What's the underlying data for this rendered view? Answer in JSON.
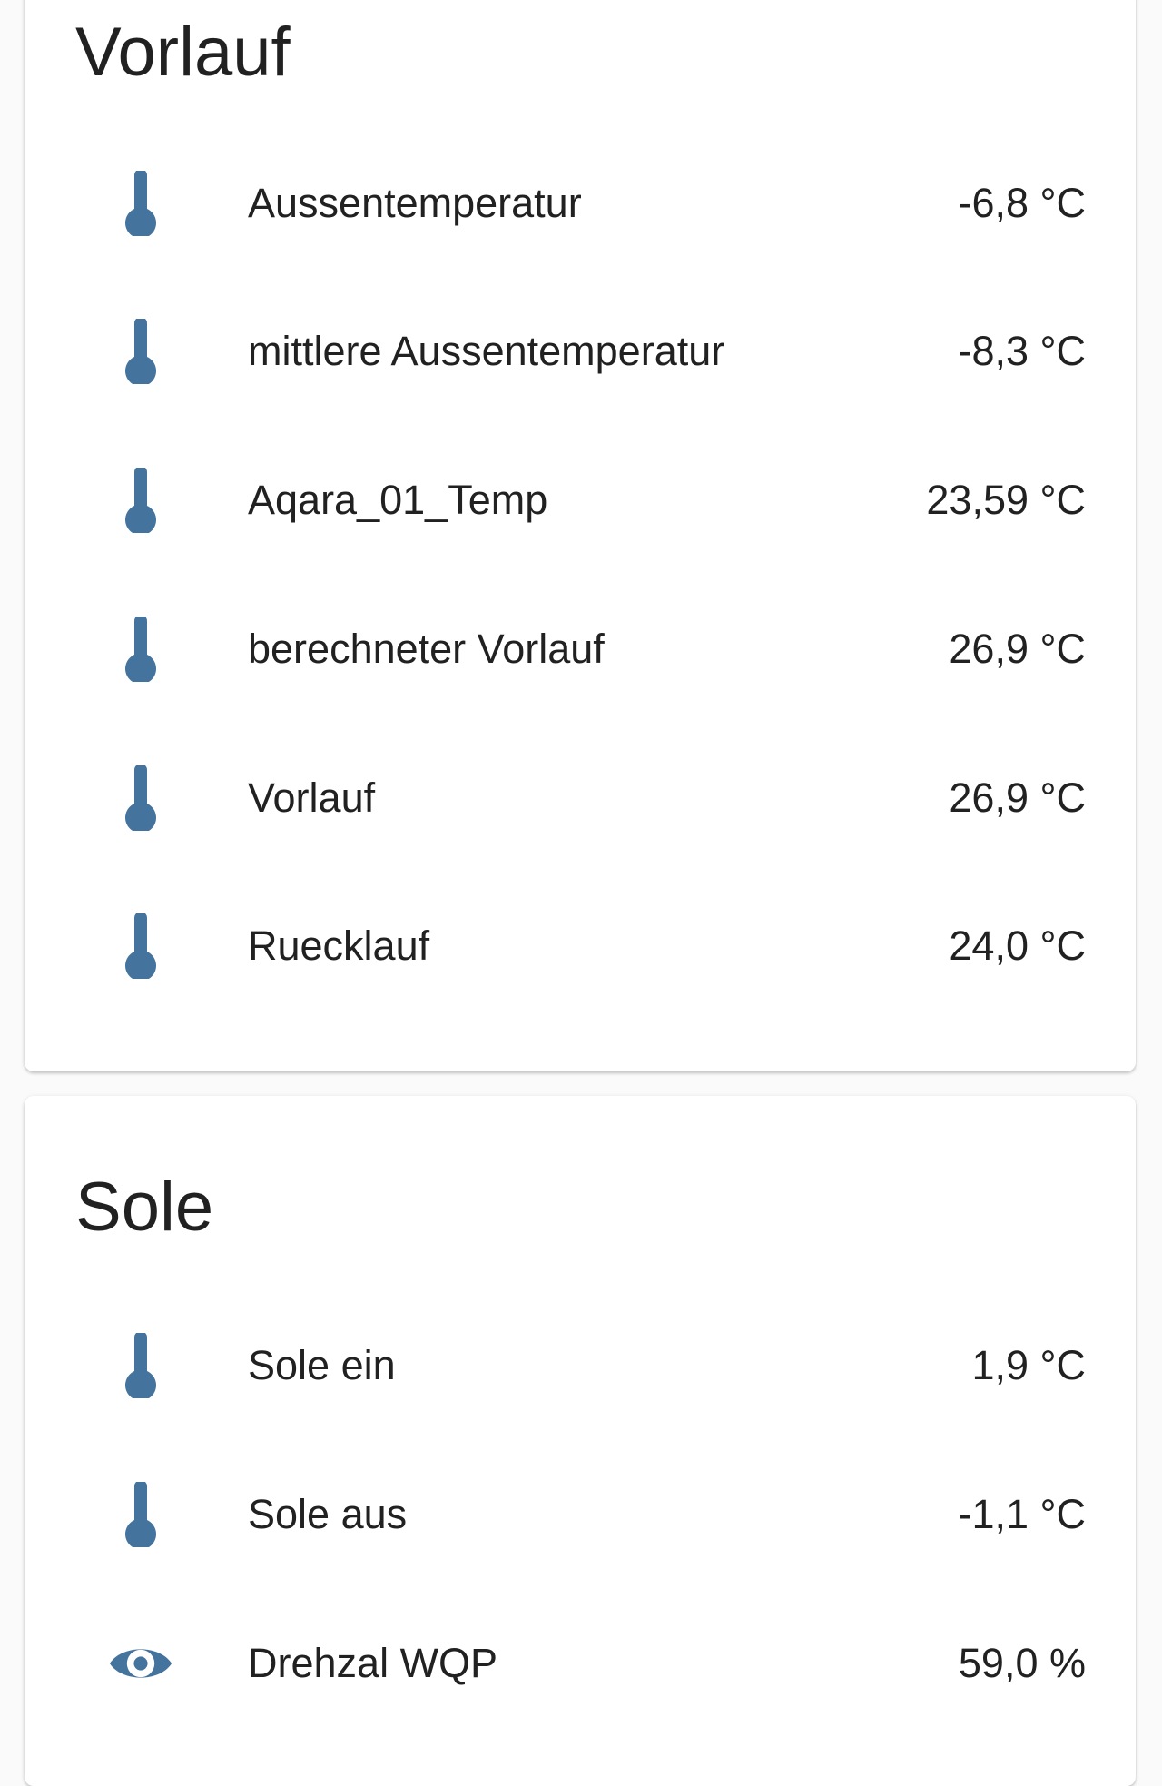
{
  "colors": {
    "icon": "#44739e",
    "card_background": "#ffffff",
    "page_background": "#fafafa",
    "text": "#212121"
  },
  "cards": [
    {
      "title": "Vorlauf",
      "rows": [
        {
          "icon": "thermometer-icon",
          "label": "Aussentemperatur",
          "value": "-6,8 °C"
        },
        {
          "icon": "thermometer-icon",
          "label": "mittlere Aussentemperatur",
          "value": "-8,3 °C"
        },
        {
          "icon": "thermometer-icon",
          "label": "Aqara_01_Temp",
          "value": "23,59 °C"
        },
        {
          "icon": "thermometer-icon",
          "label": "berechneter Vorlauf",
          "value": "26,9 °C"
        },
        {
          "icon": "thermometer-icon",
          "label": "Vorlauf",
          "value": "26,9 °C"
        },
        {
          "icon": "thermometer-icon",
          "label": "Ruecklauf",
          "value": "24,0 °C"
        }
      ]
    },
    {
      "title": "Sole",
      "rows": [
        {
          "icon": "thermometer-icon",
          "label": "Sole ein",
          "value": "1,9 °C"
        },
        {
          "icon": "thermometer-icon",
          "label": "Sole aus",
          "value": "-1,1 °C"
        },
        {
          "icon": "eye-icon",
          "label": "Drehzal WQP",
          "value": "59,0 %"
        }
      ]
    }
  ]
}
